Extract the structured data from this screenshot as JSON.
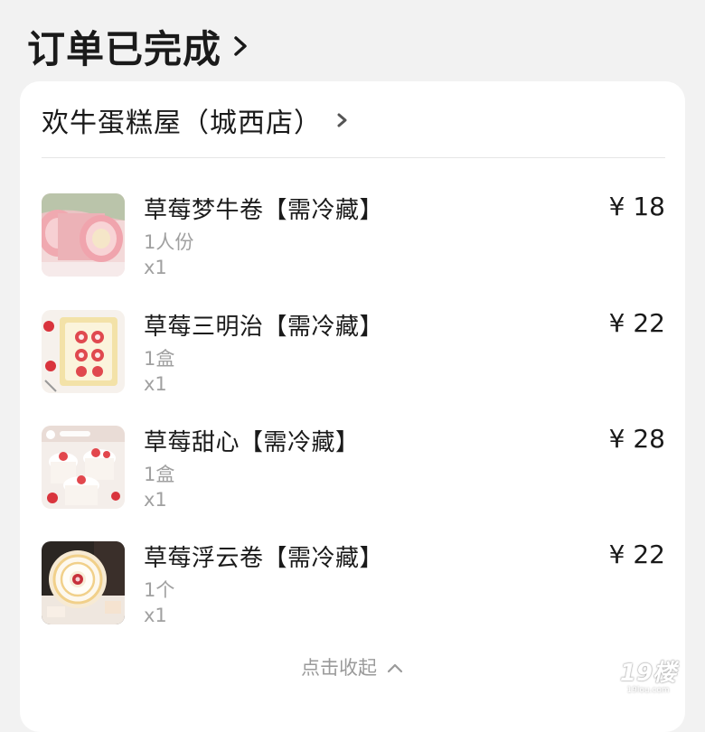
{
  "header": {
    "title": "订单已完成"
  },
  "store": {
    "name": "欢牛蛋糕屋（城西店）"
  },
  "items": [
    {
      "name": "草莓梦牛卷【需冷藏】",
      "spec": "1人份",
      "qty": "x1",
      "price": "¥ 18",
      "thumb": "pink-swiss-roll-image"
    },
    {
      "name": "草莓三明治【需冷藏】",
      "spec": "1盒",
      "qty": "x1",
      "price": "¥ 22",
      "thumb": "strawberry-sandwich-image"
    },
    {
      "name": "草莓甜心【需冷藏】",
      "spec": "1盒",
      "qty": "x1",
      "price": "¥ 28",
      "thumb": "strawberry-sweetheart-cups-image"
    },
    {
      "name": "草莓浮云卷【需冷藏】",
      "spec": "1个",
      "qty": "x1",
      "price": "¥ 22",
      "thumb": "strawberry-cloud-roll-image"
    }
  ],
  "footer": {
    "collapse_label": "点击收起"
  },
  "watermark": {
    "main": "19楼",
    "sub": "19lou.com"
  },
  "colors": {
    "page_background": "#f2f2f2",
    "card_background": "#ffffff",
    "primary_text": "#1a1a1a",
    "secondary_text": "#a0a0a0"
  }
}
